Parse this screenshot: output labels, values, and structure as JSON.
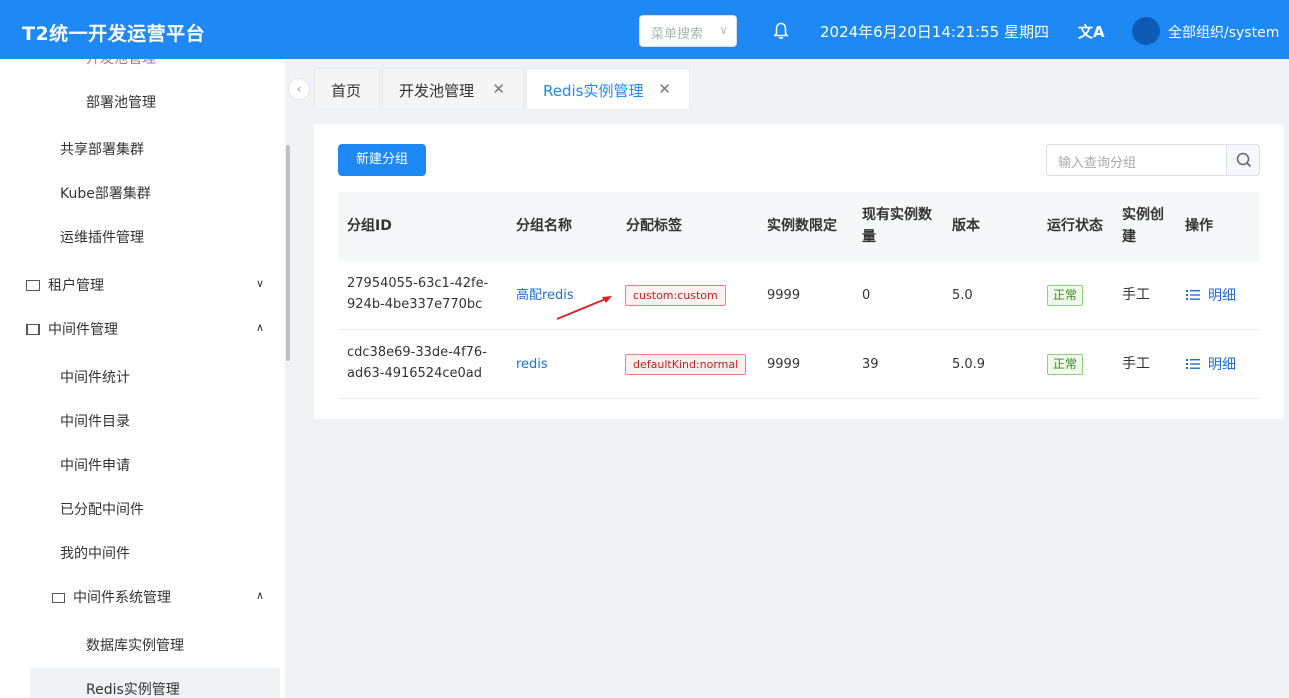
{
  "header": {
    "app_title": "T2统一开发运营平台",
    "menu_search_placeholder": "菜单搜索",
    "datetime": "2024年6月20日14:21:55 星期四",
    "translate_glyph": "文A",
    "user": "全部组织/system"
  },
  "sidebar": {
    "items": [
      {
        "label": "开发池管理"
      },
      {
        "label": "部署池管理"
      },
      {
        "label": "共享部署集群"
      },
      {
        "label": "Kube部署集群"
      },
      {
        "label": "运维插件管理"
      },
      {
        "label": "租户管理"
      },
      {
        "label": "中间件管理"
      },
      {
        "label": "中间件统计"
      },
      {
        "label": "中间件目录"
      },
      {
        "label": "中间件申请"
      },
      {
        "label": "已分配中间件"
      },
      {
        "label": "我的中间件"
      },
      {
        "label": "中间件系统管理"
      },
      {
        "label": "数据库实例管理"
      },
      {
        "label": "Redis实例管理"
      }
    ]
  },
  "tabs": [
    {
      "label": "首页"
    },
    {
      "label": "开发池管理"
    },
    {
      "label": "Redis实例管理"
    }
  ],
  "toolbar": {
    "new_group": "新建分组",
    "search_placeholder": "输入查询分组"
  },
  "table": {
    "columns": [
      "分组ID",
      "分组名称",
      "分配标签",
      "实例数限定",
      "现有实例数量",
      "版本",
      "运行状态",
      "实例创建",
      "操作"
    ],
    "rows": [
      {
        "id_line1": "27954055-63c1-42fe-",
        "id_line2": "924b-4be337e770bc",
        "name": "高配redis",
        "tag": "custom:custom",
        "limit": "9999",
        "count": "0",
        "version": "5.0",
        "status": "正常",
        "creation": "手工",
        "action": "明细"
      },
      {
        "id_line1": "cdc38e69-33de-4f76-",
        "id_line2": "ad63-4916524ce0ad",
        "name": "redis",
        "tag": "defaultKind:normal",
        "limit": "9999",
        "count": "39",
        "version": "5.0.9",
        "status": "正常",
        "creation": "手工",
        "action": "明细"
      }
    ]
  },
  "colors": {
    "primary": "#1e88f5",
    "tag_red": "#c41d1d",
    "tag_green": "#3a8a1f",
    "annotation_arrow": "#e02020"
  }
}
